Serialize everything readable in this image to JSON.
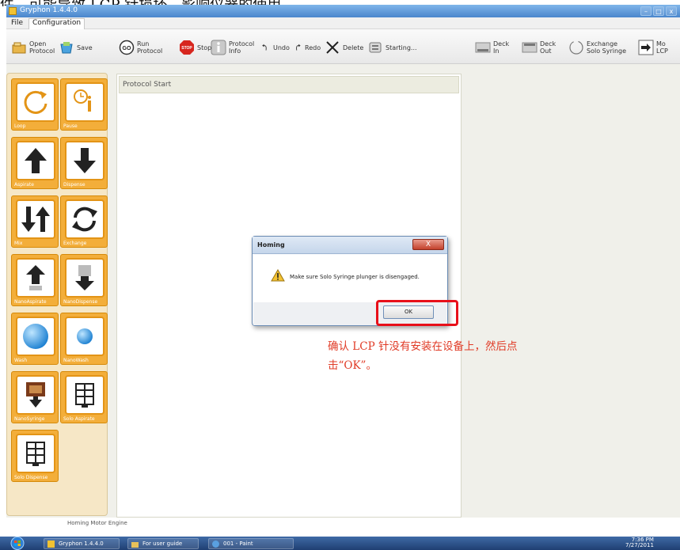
{
  "caption_top": "件，可能导致 LCP 针损坏，影响仪器的使用。",
  "window": {
    "title": "Gryphon 1.4.4.0",
    "controls": {
      "minimize": "–",
      "maximize": "□",
      "close": "x"
    }
  },
  "menu": [
    {
      "label": "File"
    },
    {
      "label": "Configuration"
    }
  ],
  "toolbar": {
    "open_protocol": "Open\nProtocol",
    "save": "Save",
    "run_protocol": "Run\nProtocol",
    "run_icon_text": "GO",
    "stop": "Stop",
    "stop_icon_text": "STOP",
    "protocol_info": "Protocol\nInfo",
    "undo": "Undo",
    "redo": "Redo",
    "delete": "Delete",
    "starting": "Starting...",
    "deck_in": "Deck\nIn",
    "deck_out": "Deck\nOut",
    "exchange_solo_syringe": "Exchange\nSolo Syringe",
    "move_lcp": "Mo\nLCP"
  },
  "palette": [
    {
      "label": "Loop"
    },
    {
      "label": "Pause"
    },
    {
      "label": "Aspirate"
    },
    {
      "label": "Dispense"
    },
    {
      "label": "Mix"
    },
    {
      "label": "Exchange"
    },
    {
      "label": "NanoAspirate"
    },
    {
      "label": "NanoDispense"
    },
    {
      "label": "Wash"
    },
    {
      "label": "NanoWash"
    },
    {
      "label": "NanoSyringe"
    },
    {
      "label": "Solo Aspirate"
    },
    {
      "label": "Solo Dispense"
    }
  ],
  "status_text": "Homing Motor Engine",
  "protocol_panel": {
    "header": "Protocol Start"
  },
  "dialog": {
    "title": "Homing",
    "close_label": "X",
    "message": "Make sure Solo Syringe plunger is disengaged.",
    "ok_label": "OK"
  },
  "annotation": "确认 LCP 针没有安装在设备上，然后点击“OK”。",
  "taskbar": {
    "tasks": [
      {
        "label": "Gryphon 1.4.4.0"
      },
      {
        "label": "For user guide"
      },
      {
        "label": "001 - Paint"
      }
    ],
    "tray_time": "7:36 PM",
    "tray_date": "7/27/2011"
  },
  "colors": {
    "tile_orange": "#f3ae3a",
    "highlight_red": "#e8101a",
    "annotation_red": "#e03a25",
    "titlebar_blue": "#4a86cc"
  }
}
